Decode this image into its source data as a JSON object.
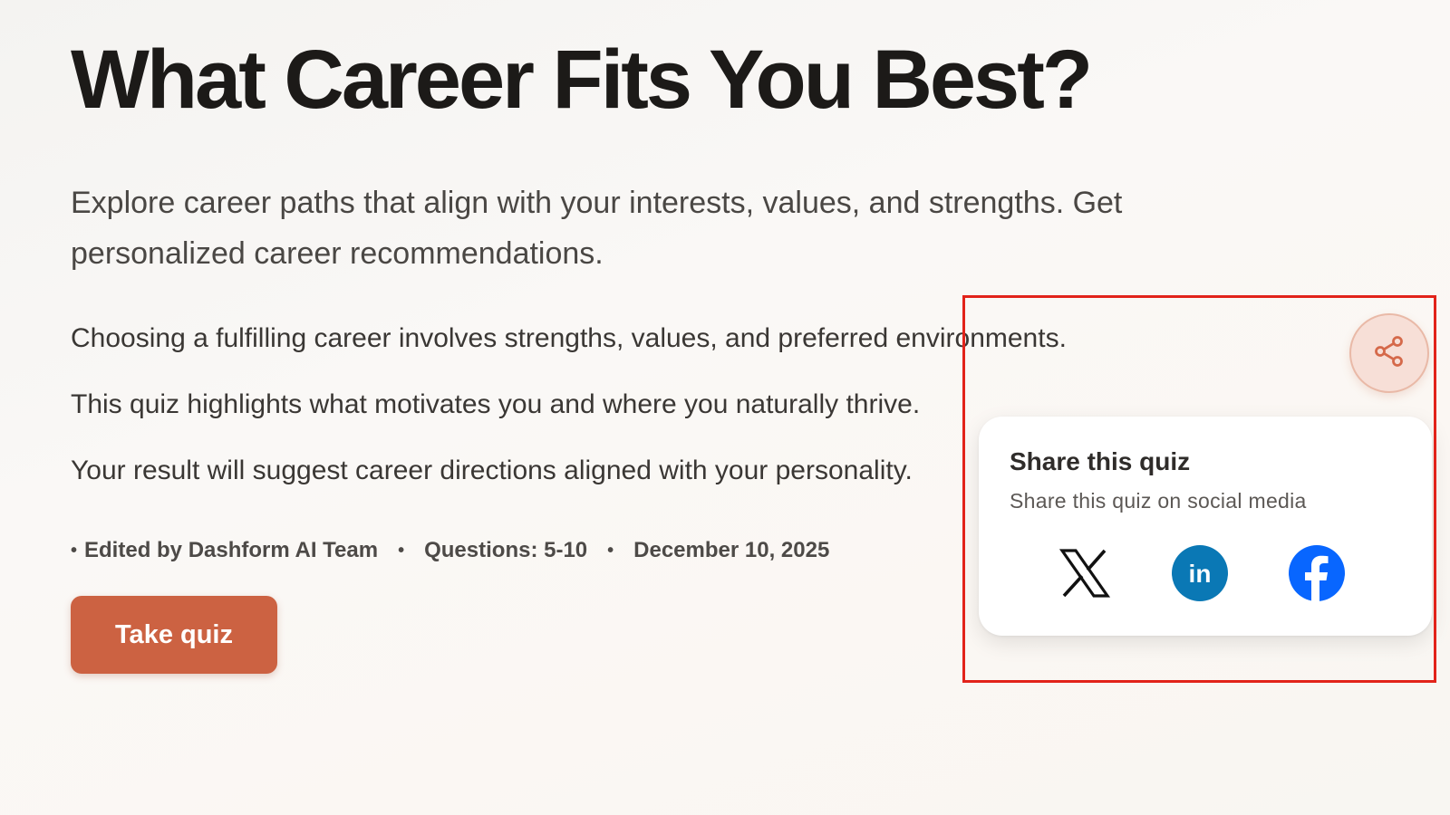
{
  "quiz": {
    "title": "What Career Fits You Best?",
    "subtitle": "Explore career paths that align with your interests, values, and strengths. Get personalized career recommendations.",
    "body_lines": [
      "Choosing a fulfilling career involves strengths, values, and preferred environments.",
      "This quiz highlights what motivates you and where you naturally thrive.",
      "Your result will suggest career directions aligned with your personality."
    ],
    "meta": {
      "editor": "Edited by Dashform AI Team",
      "questions": "Questions: 5-10",
      "date": "December 10, 2025"
    },
    "cta_label": "Take quiz"
  },
  "share": {
    "fab_icon": "share-icon",
    "card_title": "Share this quiz",
    "card_subtitle": "Share this quiz on social media",
    "platforms": [
      {
        "name": "X",
        "icon": "x-icon"
      },
      {
        "name": "LinkedIn",
        "icon": "linkedin-icon",
        "glyph": "in",
        "color": "#0a78b5"
      },
      {
        "name": "Facebook",
        "icon": "facebook-icon",
        "color": "#0866ff"
      }
    ]
  },
  "colors": {
    "accent": "#cc6242",
    "highlight": "#e2231a"
  }
}
